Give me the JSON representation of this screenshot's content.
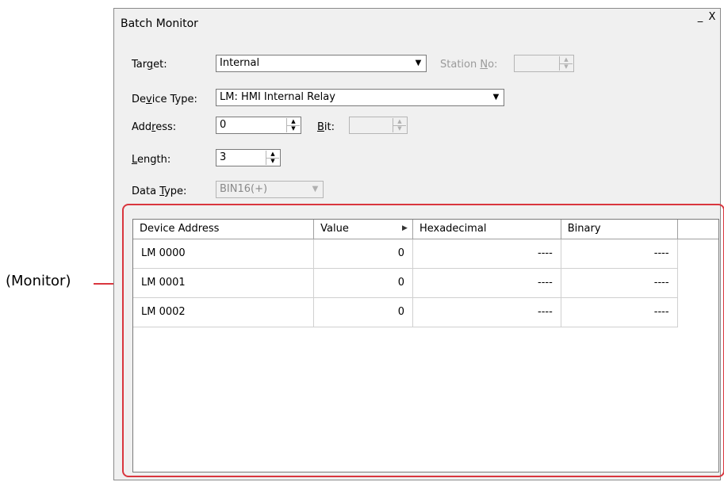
{
  "window": {
    "title": "Batch Monitor",
    "minimize": "_",
    "close": "X"
  },
  "form": {
    "target": {
      "label_pre": "Tar",
      "label_u": "g",
      "label_post": "et:",
      "value": "Internal"
    },
    "station": {
      "label_pre": "Station ",
      "label_u": "N",
      "label_post": "o:",
      "value": ""
    },
    "device_type": {
      "label_pre": "De",
      "label_u": "v",
      "label_post": "ice Type:",
      "value": "LM: HMI Internal Relay"
    },
    "address": {
      "label_pre": "Add",
      "label_u": "r",
      "label_post": "ess:",
      "value": "0"
    },
    "bit": {
      "label_pre": "",
      "label_u": "B",
      "label_post": "it:",
      "value": ""
    },
    "length": {
      "label_pre": "",
      "label_u": "L",
      "label_post": "ength:",
      "value": "3"
    },
    "data_type": {
      "label_pre": "Data ",
      "label_u": "T",
      "label_post": "ype:",
      "value": "BIN16(+)"
    }
  },
  "table": {
    "columns": [
      "Device Address",
      "Value",
      "Hexadecimal",
      "Binary"
    ],
    "rows": [
      {
        "address": "LM 0000",
        "value": "0",
        "hex": "----",
        "binary": "----"
      },
      {
        "address": "LM 0001",
        "value": "0",
        "hex": "----",
        "binary": "----"
      },
      {
        "address": "LM 0002",
        "value": "0",
        "hex": "----",
        "binary": "----"
      }
    ]
  },
  "annotation": {
    "label": "(Monitor)",
    "color": "#d9363e"
  }
}
